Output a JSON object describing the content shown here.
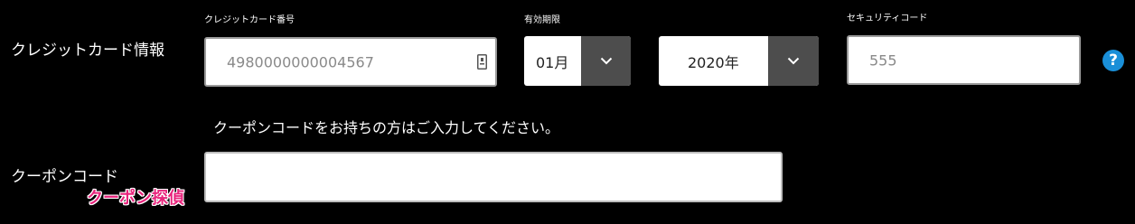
{
  "credit_card": {
    "label": "クレジットカード情報",
    "number_label": "クレジットカード番号",
    "number_value": "4980000000004567",
    "expiry_label": "有効期限",
    "month_value": "01月",
    "year_value": "2020年",
    "security_label": "セキュリティコード",
    "security_value": "555",
    "help_symbol": "?"
  },
  "coupon": {
    "hint": "クーポンコードをお持ちの方はご入力してください。",
    "label": "クーポンコード",
    "value": "",
    "brand_watermark": "クーポン探偵"
  },
  "colors": {
    "background": "#000000",
    "help_icon": "#1a8fd8",
    "select_button": "#4d4d4d",
    "watermark": "#e8247c"
  },
  "icons": [
    "card-autofill-icon",
    "chevron-down-icon",
    "help-icon"
  ]
}
